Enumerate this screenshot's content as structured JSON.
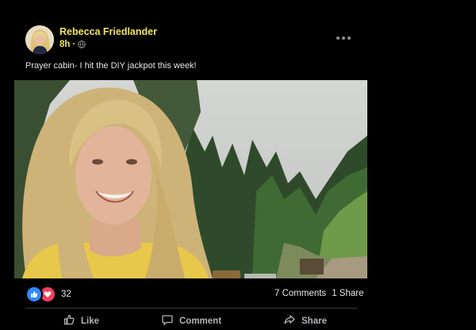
{
  "post": {
    "author": "Rebecca Friedlander",
    "time": "8h",
    "separator": "·",
    "privacy_icon": "globe-icon",
    "caption": "Prayer cabin- I hit the DIY jackpot this week!",
    "more_icon": "more-options-icon",
    "reactions": {
      "icons": [
        "like-icon",
        "love-icon"
      ],
      "count": "32"
    },
    "comments": "7 Comments",
    "shares": "1 Share",
    "actions": [
      {
        "label": "Like",
        "icon": "thumbs-up-icon"
      },
      {
        "label": "Comment",
        "icon": "comment-icon"
      },
      {
        "label": "Share",
        "icon": "share-icon"
      }
    ]
  },
  "colors": {
    "background": "#000000",
    "author_text": "#f2e35a",
    "like": "#2d88ff",
    "love": "#f33e58"
  }
}
